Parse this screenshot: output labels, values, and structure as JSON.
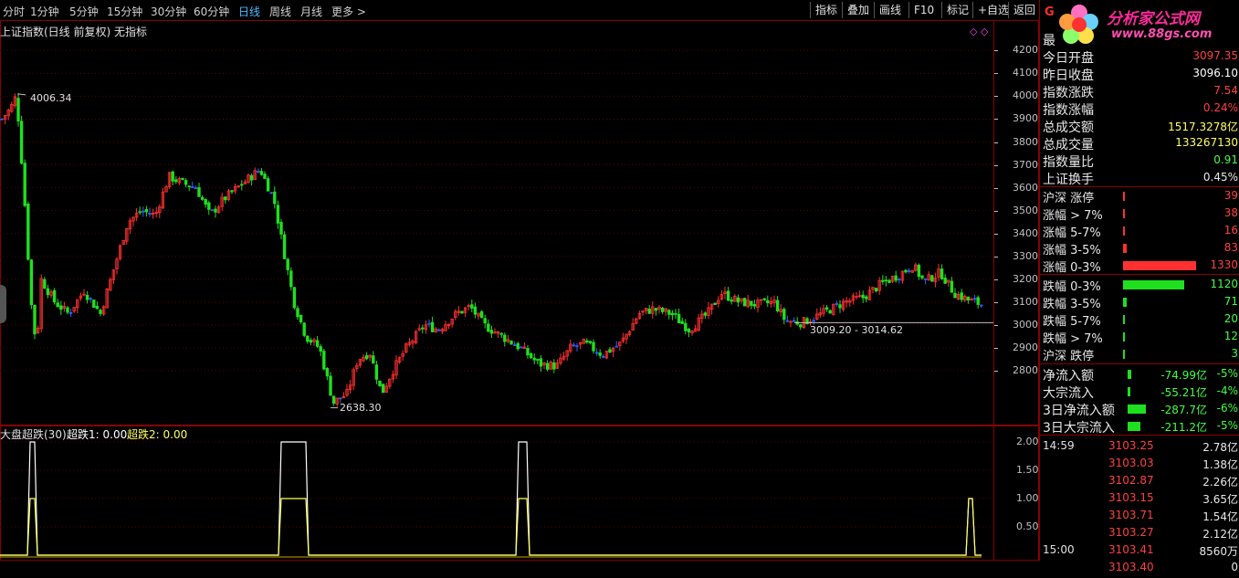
{
  "toolbar": {
    "periods": [
      {
        "label": "分时",
        "active": false
      },
      {
        "label": "1分钟",
        "active": false
      },
      {
        "label": "5分钟",
        "active": false
      },
      {
        "label": "15分钟",
        "active": false
      },
      {
        "label": "30分钟",
        "active": false
      },
      {
        "label": "60分钟",
        "active": false
      },
      {
        "label": "日线",
        "active": true
      },
      {
        "label": "周线",
        "active": false
      },
      {
        "label": "月线",
        "active": false
      },
      {
        "label": "更多 >",
        "active": false
      }
    ],
    "buttons": [
      "指标",
      "叠加",
      "画线",
      "F10",
      "标记",
      "+自选",
      "返回"
    ]
  },
  "main_chart": {
    "title": "上证指数(日线 前复权) 无指标",
    "high_label": "4006.34",
    "low_label": "2638.30",
    "range_label": "3009.20 - 3014.62",
    "y_ticks": [
      "4200",
      "4100",
      "4000",
      "3900",
      "3800",
      "3700",
      "3600",
      "3500",
      "3400",
      "3300",
      "3200",
      "3100",
      "3000",
      "2900",
      "2800"
    ]
  },
  "indicator": {
    "name": "大盘超跌(30)",
    "line1_label": "超跌1: 0.00",
    "line2_label": "超跌2: 0.00",
    "y_ticks": [
      "2.00",
      "1.50",
      "1.00",
      "0.50"
    ]
  },
  "colors": {
    "up": "#ff3030",
    "down": "#1ee01e",
    "flat": "#3060ff",
    "border": "#8a0000",
    "line1": "#ffffff",
    "line2": "#ffff60"
  },
  "chart_data": {
    "type": "line",
    "title": "",
    "series": [
      {
        "name": "超跌1",
        "points": [
          [
            0,
            0
          ],
          [
            1,
            0
          ],
          [
            2,
            2
          ],
          [
            3,
            0
          ],
          [
            4,
            0
          ],
          [
            5,
            2
          ],
          [
            6,
            2
          ],
          [
            7,
            0
          ],
          [
            8,
            0
          ],
          [
            9,
            2
          ],
          [
            10,
            0
          ],
          [
            11,
            0
          ],
          [
            12,
            1
          ],
          [
            13,
            0
          ]
        ]
      },
      {
        "name": "超跌2",
        "points": [
          [
            0,
            0
          ],
          [
            1,
            0
          ],
          [
            2,
            1
          ],
          [
            3,
            0
          ],
          [
            4,
            0
          ],
          [
            5,
            1
          ],
          [
            6,
            1
          ],
          [
            7,
            0
          ],
          [
            8,
            0
          ],
          [
            9,
            1
          ],
          [
            10,
            0
          ],
          [
            11,
            0
          ],
          [
            12,
            1
          ],
          [
            13,
            0
          ]
        ]
      }
    ],
    "ylim": [
      0,
      2.2
    ]
  },
  "panel": {
    "logo_text": "分析家公式网",
    "logo_url": "www.88gs.com",
    "logo_letter": "G",
    "rows1": [
      {
        "label": "最",
        "value": "",
        "color": "#ff4040"
      },
      {
        "label": "今日开盘",
        "value": "3097.35",
        "color": "#ff4040"
      },
      {
        "label": "昨日收盘",
        "value": "3096.10",
        "color": "#ffffff"
      },
      {
        "label": "指数涨跌",
        "value": "7.54",
        "color": "#ff4040"
      },
      {
        "label": "指数涨幅",
        "value": "0.24%",
        "color": "#ff4040"
      },
      {
        "label": "总成交额",
        "value": "1517.3278亿",
        "color": "#ffff60"
      },
      {
        "label": "总成交量",
        "value": "133267130",
        "color": "#ffff60"
      },
      {
        "label": "指数量比",
        "value": "0.91",
        "color": "#40ff40"
      },
      {
        "label": "上证换手",
        "value": "0.45%",
        "color": "#e8e8e8"
      }
    ],
    "rows2": [
      {
        "label": "沪深 涨停",
        "value": "39",
        "color": "#ff4040",
        "bar": 0.02,
        "barColor": "#ff3030"
      },
      {
        "label": "涨幅 > 7%",
        "value": "38",
        "color": "#ff4040",
        "bar": 0.02,
        "barColor": "#ff3030"
      },
      {
        "label": "涨幅 5-7%",
        "value": "16",
        "color": "#ff4040",
        "bar": 0.01,
        "barColor": "#ff3030"
      },
      {
        "label": "涨幅 3-5%",
        "value": "83",
        "color": "#ff4040",
        "bar": 0.05,
        "barColor": "#ff3030"
      },
      {
        "label": "涨幅 0-3%",
        "value": "1330",
        "color": "#ff4040",
        "bar": 1.0,
        "barColor": "#ff3030"
      }
    ],
    "rows3": [
      {
        "label": "跌幅 0-3%",
        "value": "1120",
        "color": "#40ff40",
        "bar": 0.84,
        "barColor": "#1ee01e"
      },
      {
        "label": "跌幅 3-5%",
        "value": "71",
        "color": "#40ff40",
        "bar": 0.05,
        "barColor": "#1ee01e"
      },
      {
        "label": "跌幅 5-7%",
        "value": "20",
        "color": "#40ff40",
        "bar": 0.01,
        "barColor": "#1ee01e"
      },
      {
        "label": "跌幅 > 7%",
        "value": "12",
        "color": "#40ff40",
        "bar": 0.01,
        "barColor": "#1ee01e"
      },
      {
        "label": "沪深 跌停",
        "value": "3",
        "color": "#40ff40",
        "bar": 0.005,
        "barColor": "#1ee01e"
      }
    ],
    "rows4": [
      {
        "label": "净流入额",
        "value": "-74.99亿",
        "pct": "-5%",
        "bar": 0.2
      },
      {
        "label": "大宗流入",
        "value": "-55.21亿",
        "pct": "-4%",
        "bar": 0.15
      },
      {
        "label": "3日净流入额",
        "value": "-287.7亿",
        "pct": "-6%",
        "bar": 0.9
      },
      {
        "label": "3日大宗流入",
        "value": "-211.2亿",
        "pct": "-5%",
        "bar": 0.65
      }
    ],
    "ticks": [
      {
        "time": "14:59",
        "price": "3103.25",
        "amt": "2.78亿"
      },
      {
        "time": "",
        "price": "3103.03",
        "amt": "1.38亿"
      },
      {
        "time": "",
        "price": "3102.87",
        "amt": "2.26亿"
      },
      {
        "time": "",
        "price": "3103.15",
        "amt": "3.65亿"
      },
      {
        "time": "",
        "price": "3103.71",
        "amt": "1.54亿"
      },
      {
        "time": "",
        "price": "3103.27",
        "amt": "2.12亿"
      },
      {
        "time": "15:00",
        "price": "3103.41",
        "amt": "8560万"
      },
      {
        "time": "",
        "price": "3103.40",
        "amt": "0"
      }
    ]
  }
}
